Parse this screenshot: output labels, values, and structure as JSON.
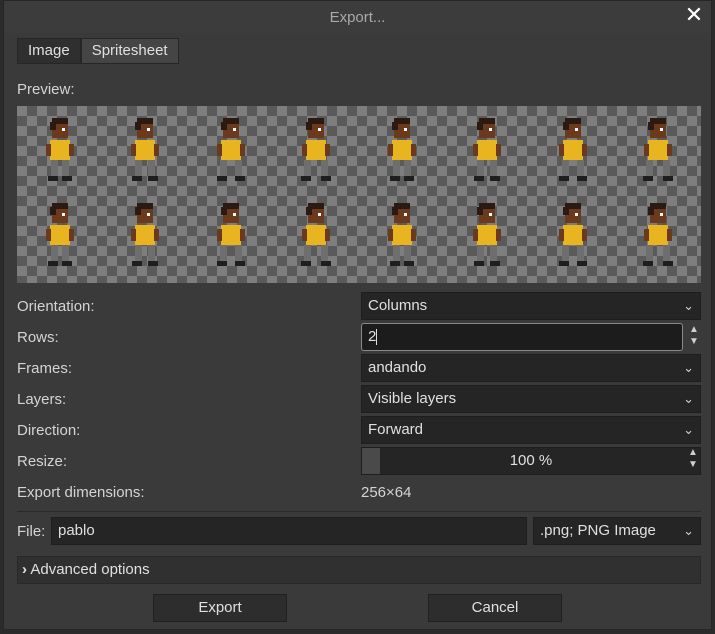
{
  "dialog": {
    "title": "Export...",
    "close_glyph": "✕"
  },
  "tabs": [
    {
      "label": "Image",
      "active": false
    },
    {
      "label": "Spritesheet",
      "active": true
    }
  ],
  "preview": {
    "label": "Preview:",
    "rows": 2,
    "columns": 8
  },
  "options": {
    "orientation": {
      "label": "Orientation:",
      "value": "Columns"
    },
    "rows": {
      "label": "Rows:",
      "value": "2"
    },
    "frames": {
      "label": "Frames:",
      "value": "andando"
    },
    "layers": {
      "label": "Layers:",
      "value": "Visible layers"
    },
    "direction": {
      "label": "Direction:",
      "value": "Forward"
    },
    "resize": {
      "label": "Resize:",
      "value": "100 %"
    },
    "export_dimensions": {
      "label": "Export dimensions:",
      "value": "256×64"
    }
  },
  "file": {
    "label": "File:",
    "value": "pablo",
    "format": ".png; PNG Image"
  },
  "advanced": {
    "label": "Advanced options",
    "chevron": "›"
  },
  "buttons": {
    "export": "Export",
    "cancel": "Cancel"
  },
  "icons": {
    "dropdown": "chevron-down-icon",
    "spin": "spin-arrows-icon",
    "close": "close-icon"
  },
  "colors": {
    "shirt": "#e8b420",
    "skin": "#6b3a1e",
    "hair": "#2a1a12",
    "pants": "#6e6e6e",
    "shoes": "#1e1e1e"
  }
}
